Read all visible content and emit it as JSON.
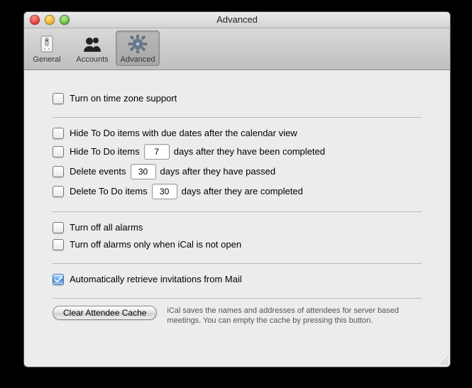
{
  "window": {
    "title": "Advanced"
  },
  "toolbar": {
    "items": [
      {
        "label": "General"
      },
      {
        "label": "Accounts"
      },
      {
        "label": "Advanced"
      }
    ]
  },
  "sections": {
    "timezone": {
      "turn_on_tz": "Turn on time zone support"
    },
    "todo": {
      "hide_due_after_view": "Hide To Do items with due dates after the calendar view",
      "hide_todo_prefix": "Hide To Do items",
      "hide_todo_days": "7",
      "hide_todo_suffix": "days after they have been completed",
      "delete_events_prefix": "Delete events",
      "delete_events_days": "30",
      "delete_events_suffix": "days after they have passed",
      "delete_todo_prefix": "Delete To Do items",
      "delete_todo_days": "30",
      "delete_todo_suffix": "days after they are completed"
    },
    "alarms": {
      "off_all": "Turn off all alarms",
      "off_when_closed": "Turn off alarms only when iCal is not open"
    },
    "mail": {
      "auto_retrieve": "Automatically retrieve invitations from Mail"
    },
    "cache": {
      "button": "Clear Attendee Cache",
      "desc": "iCal saves the names and addresses of attendees for server based meetings. You can empty the cache by pressing this button."
    }
  }
}
